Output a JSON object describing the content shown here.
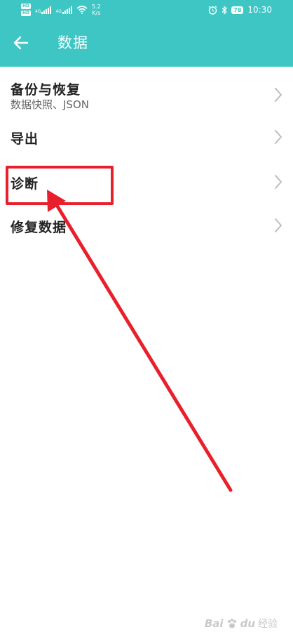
{
  "status_bar": {
    "hd1": "HD",
    "hd2": "HD",
    "net1": "4G",
    "net2": "4G",
    "speed_value": "5.2",
    "speed_unit": "K/s",
    "battery": "78",
    "time": "10:30"
  },
  "app_bar": {
    "title": "数据",
    "back_icon": "arrow-left-icon"
  },
  "list": {
    "items": [
      {
        "label": "备份与恢复",
        "sublabel": "数据快照、JSON"
      },
      {
        "label": "导出"
      },
      {
        "label": "诊断"
      },
      {
        "label": "修复数据"
      }
    ]
  },
  "annotation": {
    "color": "#e8202c"
  },
  "watermark": {
    "brand": "Bai",
    "brand2": "du",
    "cn": "经验"
  },
  "colors": {
    "accent": "#3ec6c4",
    "text": "#222222",
    "subtext": "#666666",
    "chevron": "#bdbdbd"
  }
}
